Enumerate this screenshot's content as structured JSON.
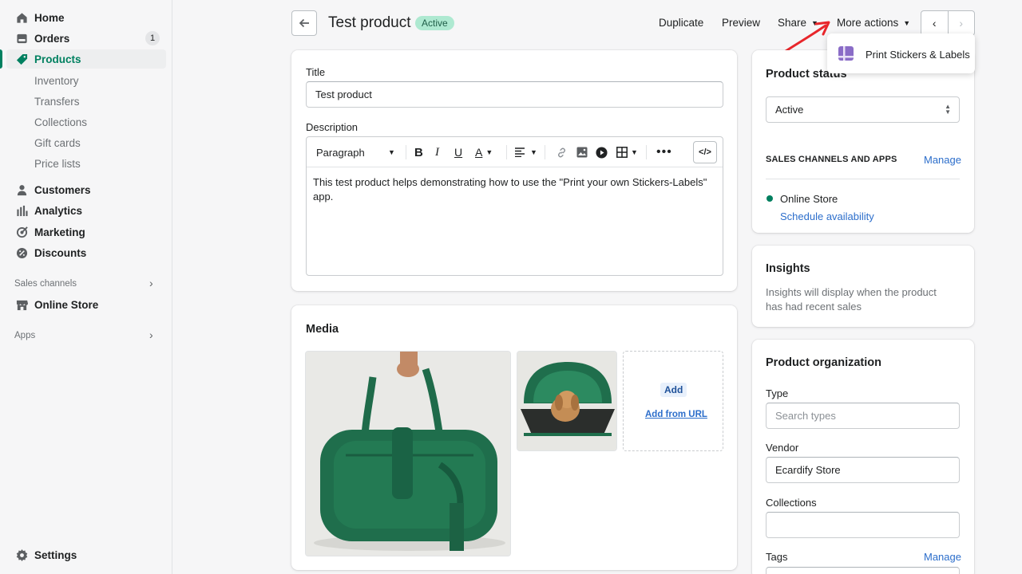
{
  "sidebar": {
    "items": [
      {
        "label": "Home",
        "icon": "home-icon"
      },
      {
        "label": "Orders",
        "icon": "orders-icon",
        "badge": "1"
      },
      {
        "label": "Products",
        "icon": "tag-icon"
      },
      {
        "label": "Inventory"
      },
      {
        "label": "Transfers"
      },
      {
        "label": "Collections"
      },
      {
        "label": "Gift cards"
      },
      {
        "label": "Price lists"
      },
      {
        "label": "Customers",
        "icon": "person-icon"
      },
      {
        "label": "Analytics",
        "icon": "bar-chart-icon"
      },
      {
        "label": "Marketing",
        "icon": "target-icon"
      },
      {
        "label": "Discounts",
        "icon": "discount-icon"
      }
    ],
    "sales_channels_label": "Sales channels",
    "online_store": "Online Store",
    "apps_label": "Apps",
    "settings": "Settings"
  },
  "header": {
    "title": "Test product",
    "status": "Active",
    "actions": {
      "duplicate": "Duplicate",
      "preview": "Preview",
      "share": "Share",
      "more_actions": "More actions"
    },
    "dropdown_item": "Print Stickers & Labels"
  },
  "main": {
    "title_label": "Title",
    "title_value": "Test product",
    "description_label": "Description",
    "paragraph_select": "Paragraph",
    "description_text": "This test product helps demonstrating how to use the \"Print your own Stickers-Labels\" app.",
    "media_title": "Media",
    "add_button": "Add",
    "add_from_url": "Add from URL"
  },
  "right": {
    "product_status_title": "Product status",
    "status_value": "Active",
    "sales_channels_heading": "SALES CHANNELS AND APPS",
    "manage": "Manage",
    "online_store": "Online Store",
    "schedule": "Schedule availability",
    "insights_title": "Insights",
    "insights_text": "Insights will display when the product has had recent sales",
    "org_title": "Product organization",
    "type_label": "Type",
    "type_placeholder": "Search types",
    "vendor_label": "Vendor",
    "vendor_value": "Ecardify Store",
    "collections_label": "Collections",
    "tags_label": "Tags",
    "tags_manage": "Manage"
  },
  "colors": {
    "accent": "#008060",
    "link": "#2c6ecb",
    "status_bg": "#aee9d1",
    "annotation_arrow": "#e8262b"
  }
}
